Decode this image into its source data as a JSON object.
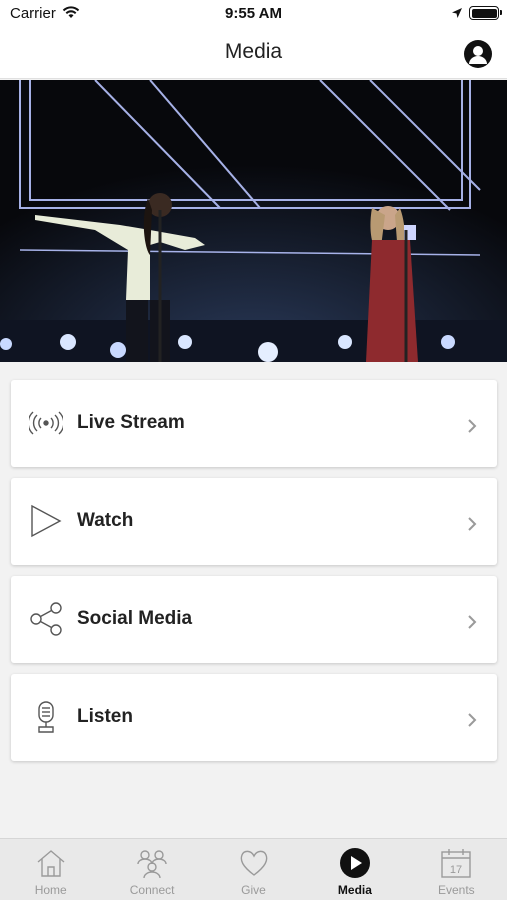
{
  "status_bar": {
    "carrier": "Carrier",
    "time": "9:55 AM"
  },
  "nav": {
    "title": "Media",
    "profile_icon": "profile-icon"
  },
  "hero": {
    "alt": "worship-singers-photo"
  },
  "menu": {
    "items": [
      {
        "label": "Live Stream",
        "icon": "broadcast-icon"
      },
      {
        "label": "Watch",
        "icon": "play-outline-icon"
      },
      {
        "label": "Social Media",
        "icon": "share-icon"
      },
      {
        "label": "Listen",
        "icon": "microphone-icon"
      }
    ]
  },
  "tabs": [
    {
      "label": "Home",
      "icon": "home-icon",
      "active": false
    },
    {
      "label": "Connect",
      "icon": "people-icon",
      "active": false
    },
    {
      "label": "Give",
      "icon": "heart-icon",
      "active": false
    },
    {
      "label": "Media",
      "icon": "play-circle-icon",
      "active": true
    },
    {
      "label": "Events",
      "icon": "calendar-icon",
      "active": false
    }
  ],
  "colors": {
    "accent": "#111111",
    "tab_inactive": "#9a9a9a",
    "tab_bar_bg": "#e9e9e9",
    "page_bg": "#f2f2f2"
  }
}
